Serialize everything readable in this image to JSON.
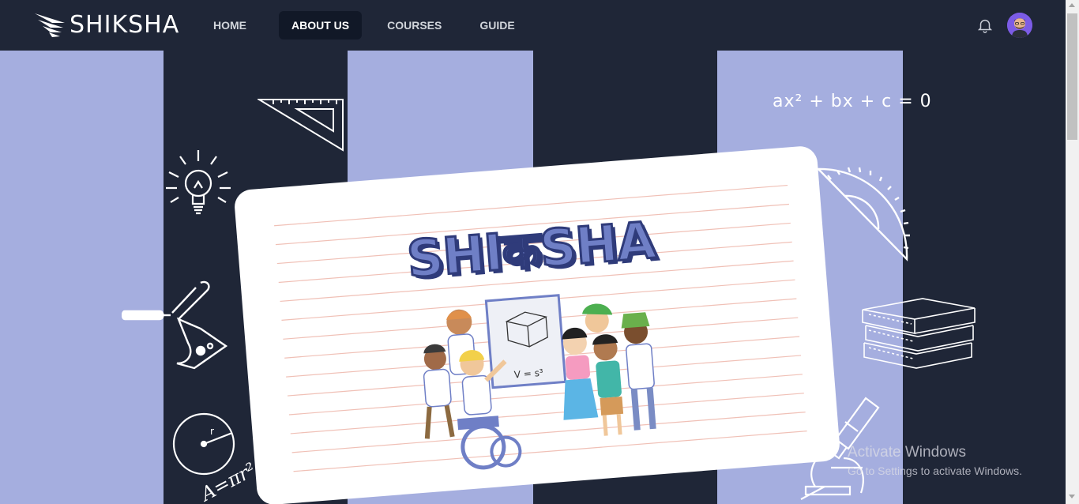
{
  "brand": {
    "name": "SHIKSHA"
  },
  "nav": {
    "items": [
      {
        "label": "HOME"
      },
      {
        "label": "ABOUT US"
      },
      {
        "label": "COURSES"
      },
      {
        "label": "GUIDE"
      }
    ],
    "active": "ABOUT US"
  },
  "header_icons": {
    "notifications": "bell-icon",
    "profile": "avatar"
  },
  "hero": {
    "card_logo": "SHIकSHA",
    "formula_quadratic": "ax² + bx + c = 0",
    "formula_circle": "A=πr²",
    "board_formula": "V = s³",
    "doodles": [
      "set-square-icon",
      "lightbulb-icon",
      "chemistry-flask-icon",
      "circle-radius-icon",
      "protractor-icon",
      "books-icon",
      "microscope-icon"
    ]
  },
  "watermark": {
    "title": "Activate Windows",
    "subtitle": "Go to Settings to activate Windows."
  },
  "colors": {
    "navy": "#1f2637",
    "lavender": "#a5aedf",
    "accent_blue": "#6f7fc6",
    "avatar_bg": "#8b5cf6"
  }
}
